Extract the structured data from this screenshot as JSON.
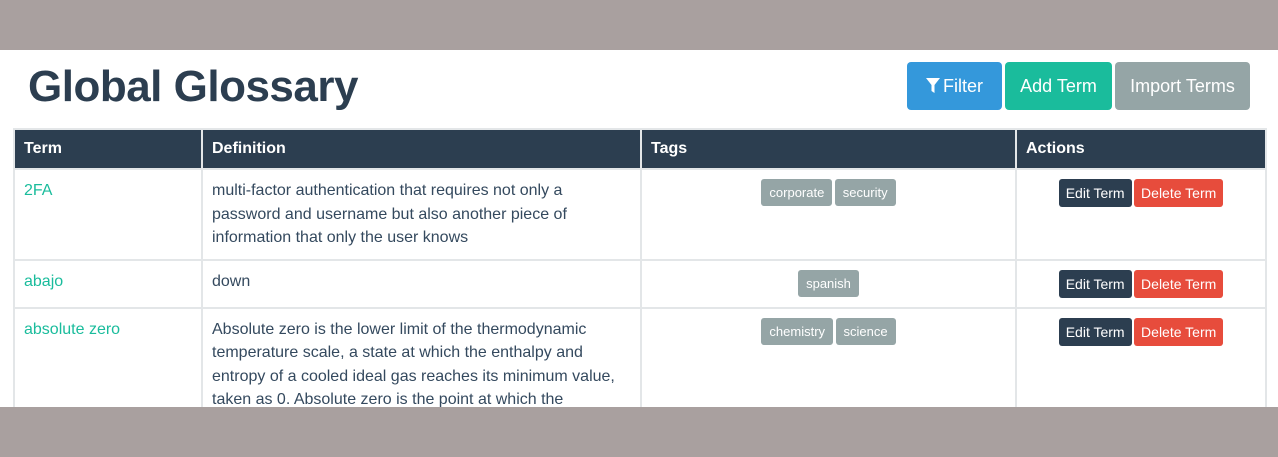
{
  "header": {
    "title": "Global Glossary",
    "filter_label": "Filter",
    "add_label": "Add Term",
    "import_label": "Import Terms"
  },
  "table": {
    "columns": [
      "Term",
      "Definition",
      "Tags",
      "Actions"
    ],
    "rows": [
      {
        "term": "2FA",
        "definition": "multi-factor authentication that requires not only a password and username but also another piece of information that only the user knows",
        "tags": [
          "corporate",
          "security"
        ],
        "edit_label": "Edit Term",
        "delete_label": "Delete Term"
      },
      {
        "term": "abajo",
        "definition": "down",
        "tags": [
          "spanish"
        ],
        "edit_label": "Edit Term",
        "delete_label": "Delete Term"
      },
      {
        "term": "absolute zero",
        "definition": "Absolute zero is the lower limit of the thermodynamic temperature scale, a state at which the enthalpy and entropy of a cooled ideal gas reaches its minimum value, taken as 0. Absolute zero is the point at which the",
        "tags": [
          "chemistry",
          "science"
        ],
        "edit_label": "Edit Term",
        "delete_label": "Delete Term"
      }
    ]
  },
  "colors": {
    "primary": "#2c3e50",
    "accent": "#1abc9c",
    "info": "#3498db",
    "muted": "#95a5a6",
    "danger": "#e74c3c"
  },
  "icons": {
    "filter": "filter-icon"
  }
}
